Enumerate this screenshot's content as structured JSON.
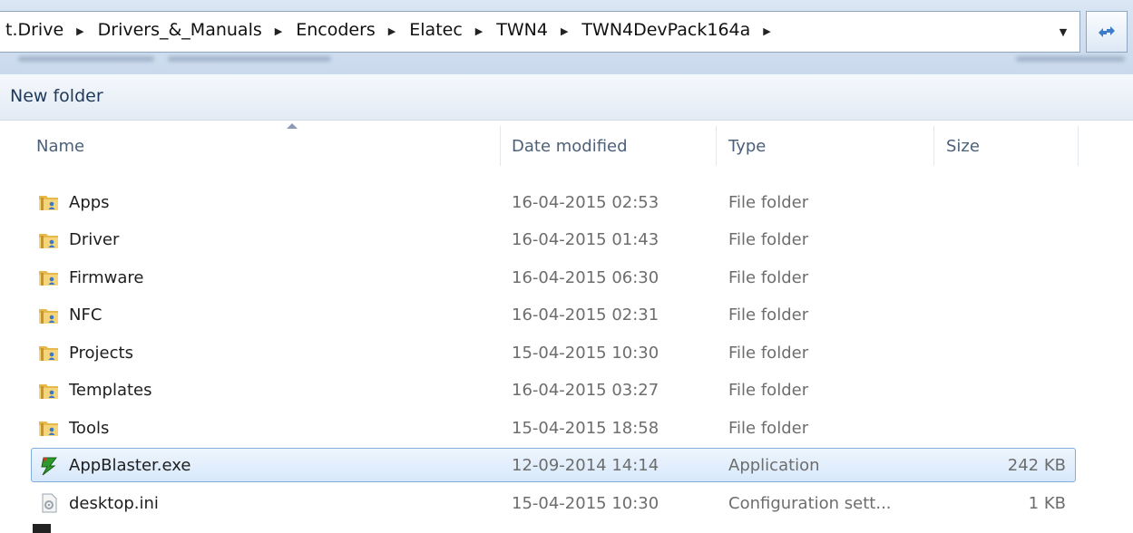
{
  "address": {
    "crumbs": [
      "t.Drive",
      "Drivers_&_Manuals",
      "Encoders",
      "Elatec",
      "TWN4",
      "TWN4DevPack164a"
    ],
    "dropdown_icon": "chevron-down-icon",
    "refresh_icon": "refresh-icon"
  },
  "toolbar": {
    "new_folder_label": "New folder"
  },
  "columns": {
    "name": "Name",
    "date": "Date modified",
    "type": "Type",
    "size": "Size"
  },
  "files": [
    {
      "name": "Apps",
      "date": "16-04-2015 02:53",
      "type": "File folder",
      "size": "",
      "icon": "folder-icon"
    },
    {
      "name": "Driver",
      "date": "16-04-2015 01:43",
      "type": "File folder",
      "size": "",
      "icon": "folder-icon"
    },
    {
      "name": "Firmware",
      "date": "16-04-2015 06:30",
      "type": "File folder",
      "size": "",
      "icon": "folder-icon"
    },
    {
      "name": "NFC",
      "date": "16-04-2015 02:31",
      "type": "File folder",
      "size": "",
      "icon": "folder-icon"
    },
    {
      "name": "Projects",
      "date": "15-04-2015 10:30",
      "type": "File folder",
      "size": "",
      "icon": "folder-icon"
    },
    {
      "name": "Templates",
      "date": "16-04-2015 03:27",
      "type": "File folder",
      "size": "",
      "icon": "folder-icon"
    },
    {
      "name": "Tools",
      "date": "15-04-2015 18:58",
      "type": "File folder",
      "size": "",
      "icon": "folder-icon"
    },
    {
      "name": "AppBlaster.exe",
      "date": "12-09-2014 14:14",
      "type": "Application",
      "size": "242 KB",
      "icon": "application-icon",
      "selected": true
    },
    {
      "name": "desktop.ini",
      "date": "15-04-2015 10:30",
      "type": "Configuration sett...",
      "size": "1 KB",
      "icon": "config-file-icon"
    }
  ],
  "colors": {
    "selection_bg": "#d7e8fb",
    "selection_border": "#84acdd",
    "header_text": "#4c607a",
    "toolbar_text": "#1e395b"
  }
}
